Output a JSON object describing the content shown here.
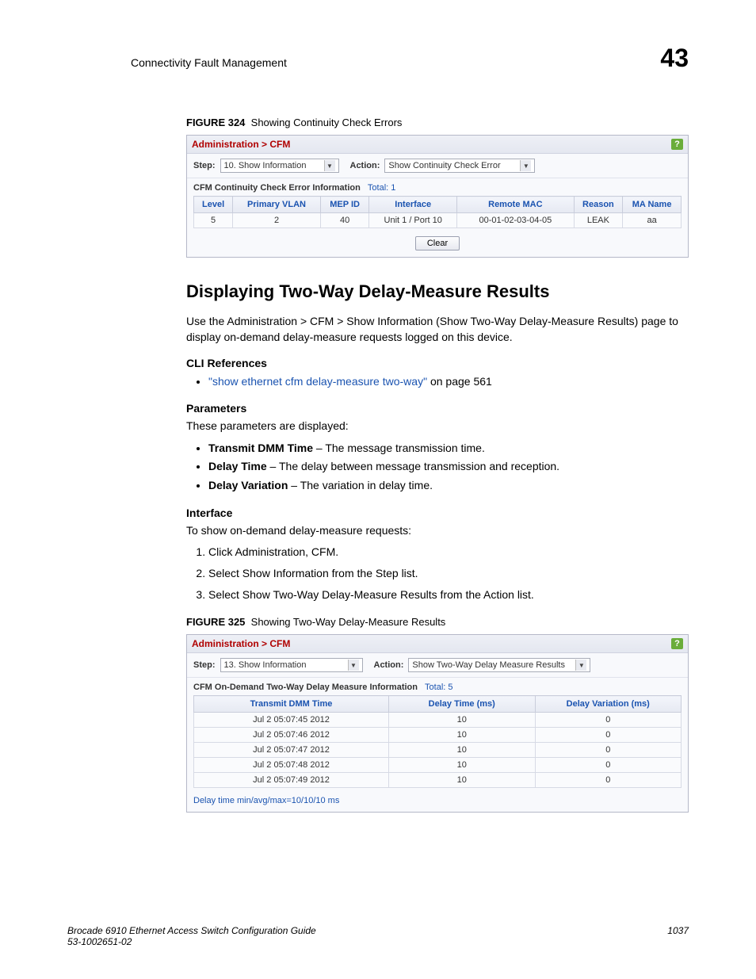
{
  "header": {
    "title": "Connectivity Fault Management",
    "chapter": "43"
  },
  "fig324": {
    "caption_label": "FIGURE 324",
    "caption_text": "Showing Continuity Check Errors",
    "breadcrumb": "Administration > CFM",
    "step_label": "Step:",
    "step_value": "10. Show Information",
    "action_label": "Action:",
    "action_value": "Show Continuity Check Error",
    "table_title": "CFM Continuity Check Error Information",
    "total_label": "Total: 1",
    "headers": {
      "h0": "Level",
      "h1": "Primary VLAN",
      "h2": "MEP ID",
      "h3": "Interface",
      "h4": "Remote MAC",
      "h5": "Reason",
      "h6": "MA Name"
    },
    "row": {
      "c0": "5",
      "c1": "2",
      "c2": "40",
      "c3": "Unit 1 / Port 10",
      "c4": "00-01-02-03-04-05",
      "c5": "LEAK",
      "c6": "aa"
    },
    "clear_btn": "Clear"
  },
  "section": {
    "title": "Displaying Two-Way Delay-Measure Results",
    "intro": "Use the Administration > CFM > Show Information (Show Two-Way Delay-Measure Results) page to display on-demand delay-measure requests logged on this device.",
    "cli_h": "CLI References",
    "cli_link": "\"show ethernet cfm delay-measure two-way\"",
    "cli_suffix": " on page 561",
    "params_h": "Parameters",
    "params_intro": "These parameters are displayed:",
    "params": {
      "p0_b": "Transmit DMM Time",
      "p0_t": " – The message transmission time.",
      "p1_b": "Delay Time",
      "p1_t": " – The delay between message transmission and reception.",
      "p2_b": "Delay Variation",
      "p2_t": " – The variation in delay time."
    },
    "iface_h": "Interface",
    "iface_intro": "To show on-demand delay-measure requests:",
    "steps": {
      "s0": "Click Administration, CFM.",
      "s1": "Select Show Information from the Step list.",
      "s2": "Select Show Two-Way Delay-Measure Results from the Action list."
    }
  },
  "fig325": {
    "caption_label": "FIGURE 325",
    "caption_text": "Showing Two-Way Delay-Measure Results",
    "breadcrumb": "Administration > CFM",
    "step_label": "Step:",
    "step_value": "13. Show Information",
    "action_label": "Action:",
    "action_value": "Show Two-Way Delay Measure Results",
    "table_title": "CFM On-Demand Two-Way Delay Measure Information",
    "total_label": "Total: 5",
    "headers": {
      "h0": "Transmit DMM Time",
      "h1": "Delay Time (ms)",
      "h2": "Delay Variation (ms)"
    },
    "rows": {
      "r0": {
        "c0": "Jul 2 05:07:45 2012",
        "c1": "10",
        "c2": "0"
      },
      "r1": {
        "c0": "Jul 2 05:07:46 2012",
        "c1": "10",
        "c2": "0"
      },
      "r2": {
        "c0": "Jul 2 05:07:47 2012",
        "c1": "10",
        "c2": "0"
      },
      "r3": {
        "c0": "Jul 2 05:07:48 2012",
        "c1": "10",
        "c2": "0"
      },
      "r4": {
        "c0": "Jul 2 05:07:49 2012",
        "c1": "10",
        "c2": "0"
      }
    },
    "summary": "Delay time min/avg/max=10/10/10 ms"
  },
  "footer": {
    "line1": "Brocade 6910 Ethernet Access Switch Configuration Guide",
    "line2": "53-1002651-02",
    "page": "1037"
  }
}
